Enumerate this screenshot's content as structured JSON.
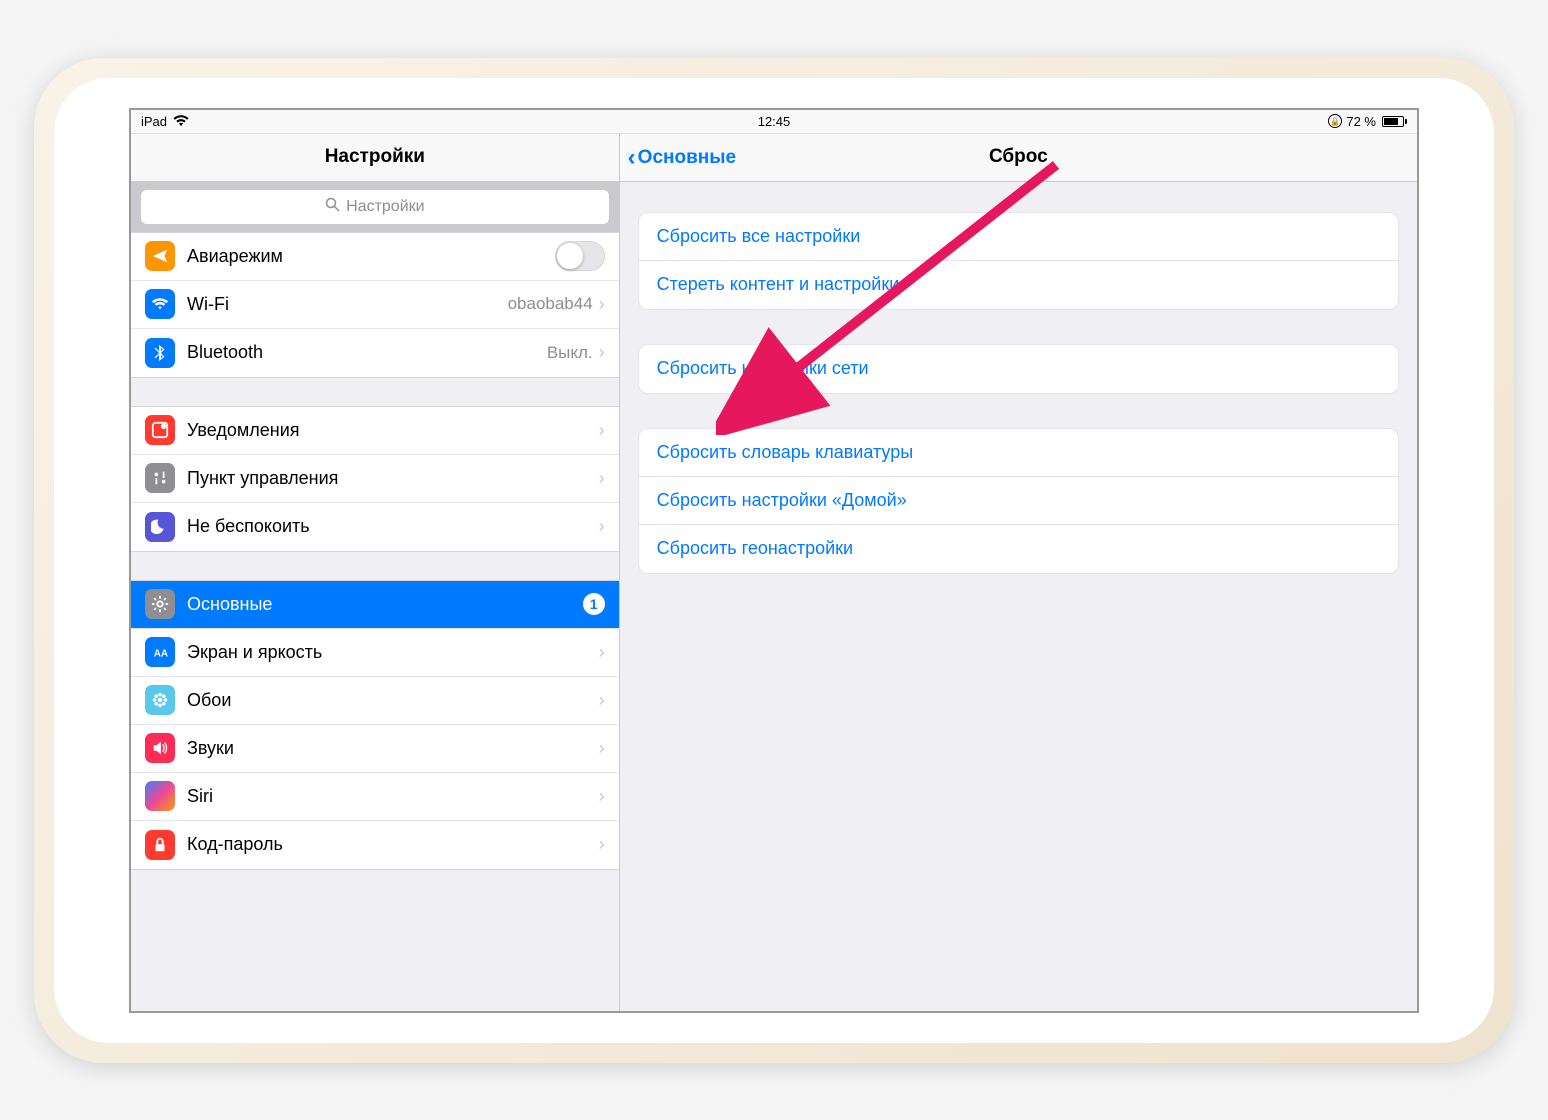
{
  "statusbar": {
    "device": "iPad",
    "time": "12:45",
    "battery_text": "72 %",
    "battery_pct": 72
  },
  "sidebar": {
    "title": "Настройки",
    "search_placeholder": "Настройки",
    "groups": [
      {
        "rows": [
          {
            "name": "airplane",
            "label": "Авиарежим",
            "icon": "airplane",
            "color": "c-orange",
            "accessory": "toggle"
          },
          {
            "name": "wifi",
            "label": "Wi-Fi",
            "icon": "wifi",
            "color": "c-blue",
            "value": "obaobab44",
            "accessory": "chevron"
          },
          {
            "name": "bluetooth",
            "label": "Bluetooth",
            "icon": "bluetooth",
            "color": "c-blue",
            "value": "Выкл.",
            "accessory": "chevron"
          }
        ]
      },
      {
        "rows": [
          {
            "name": "notifications",
            "label": "Уведомления",
            "icon": "notif",
            "color": "c-red",
            "accessory": "chevron"
          },
          {
            "name": "control-center",
            "label": "Пункт управления",
            "icon": "control",
            "color": "c-grey",
            "accessory": "chevron"
          },
          {
            "name": "dnd",
            "label": "Не беспокоить",
            "icon": "moon",
            "color": "c-purple",
            "accessory": "chevron"
          }
        ]
      },
      {
        "rows": [
          {
            "name": "general",
            "label": "Основные",
            "icon": "gear",
            "color": "c-grey",
            "selected": true,
            "badge": "1"
          },
          {
            "name": "display",
            "label": "Экран и яркость",
            "icon": "display",
            "color": "c-display",
            "accessory": "chevron"
          },
          {
            "name": "wallpaper",
            "label": "Обои",
            "icon": "flower",
            "color": "c-cyan",
            "accessory": "chevron"
          },
          {
            "name": "sounds",
            "label": "Звуки",
            "icon": "sound",
            "color": "c-pink",
            "accessory": "chevron"
          },
          {
            "name": "siri",
            "label": "Siri",
            "icon": "siri",
            "color": "",
            "accessory": "chevron"
          },
          {
            "name": "passcode",
            "label": "Код-пароль",
            "icon": "lock",
            "color": "c-redlock",
            "accessory": "chevron"
          }
        ]
      }
    ]
  },
  "detail": {
    "back_label": "Основные",
    "title": "Сброс",
    "groups": [
      {
        "rows": [
          {
            "name": "reset-all-settings",
            "label": "Сбросить все настройки"
          },
          {
            "name": "erase-all-content",
            "label": "Стереть контент и настройки"
          }
        ]
      },
      {
        "rows": [
          {
            "name": "reset-network-settings",
            "label": "Сбросить настройки сети"
          }
        ]
      },
      {
        "rows": [
          {
            "name": "reset-keyboard-dict",
            "label": "Сбросить словарь клавиатуры"
          },
          {
            "name": "reset-home-layout",
            "label": "Сбросить настройки «Домой»"
          },
          {
            "name": "reset-location-privacy",
            "label": "Сбросить геонастройки"
          }
        ]
      }
    ]
  },
  "annotation": {
    "arrow_target": "reset-network-settings",
    "arrow_color": "#e6175c"
  }
}
